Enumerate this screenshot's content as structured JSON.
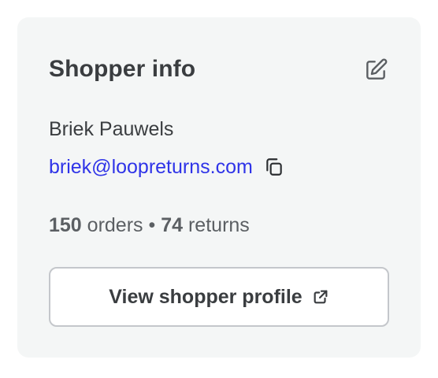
{
  "card": {
    "title": "Shopper info",
    "edit_icon": "edit-icon"
  },
  "shopper": {
    "name": "Briek Pauwels",
    "email": "briek@loopreturns.com",
    "copy_icon": "copy-icon"
  },
  "stats": {
    "orders_count": "150",
    "orders_label": "orders",
    "separator": "•",
    "returns_count": "74",
    "returns_label": "returns"
  },
  "profile_button": {
    "label": "View shopper profile",
    "icon": "external-link-icon"
  },
  "colors": {
    "card_background": "#f4f6f6",
    "text_primary": "#3a3d40",
    "text_secondary": "#5b5f63",
    "link": "#2f34e8",
    "border": "#c4c7cb"
  }
}
